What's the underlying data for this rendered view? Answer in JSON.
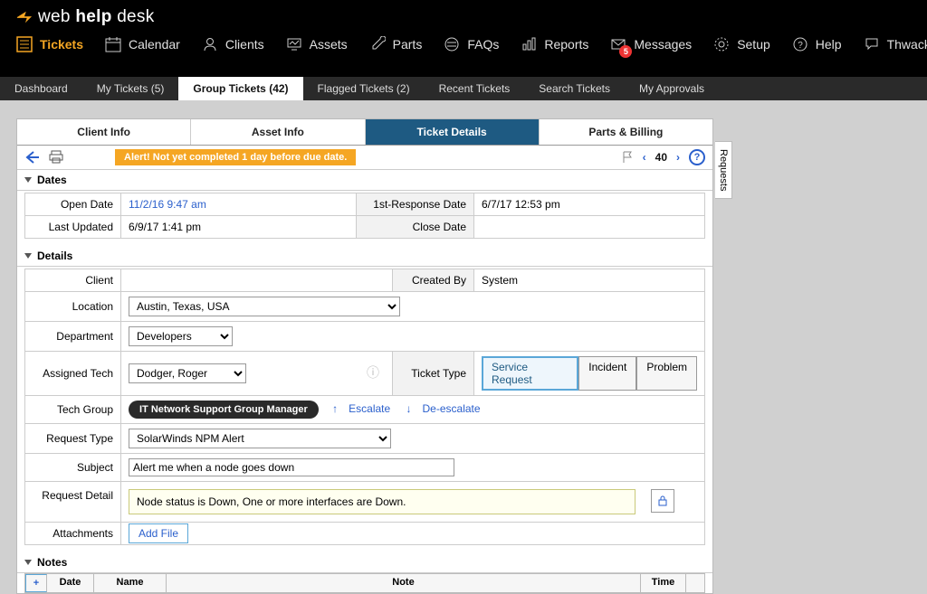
{
  "logo": {
    "part1": "web ",
    "part2": "help",
    "part3": " desk"
  },
  "mainnav": {
    "tickets": "Tickets",
    "calendar": "Calendar",
    "clients": "Clients",
    "assets": "Assets",
    "parts": "Parts",
    "faqs": "FAQs",
    "reports": "Reports",
    "messages": "Messages",
    "messages_badge": "5",
    "setup": "Setup",
    "help": "Help",
    "thwack": "Thwack"
  },
  "subnav": {
    "dashboard": "Dashboard",
    "mytickets": "My Tickets (5)",
    "grouptickets": "Group Tickets (42)",
    "flagged": "Flagged Tickets (2)",
    "recent": "Recent Tickets",
    "search": "Search Tickets",
    "approvals": "My Approvals"
  },
  "panel_tabs": {
    "clientinfo": "Client Info",
    "assetinfo": "Asset Info",
    "ticketdetails": "Ticket Details",
    "partsbilling": "Parts & Billing"
  },
  "alert": "Alert! Not yet completed 1 day before due date.",
  "pager_num": "40",
  "sections": {
    "dates": "Dates",
    "details": "Details",
    "notes": "Notes"
  },
  "dates": {
    "open_lbl": "Open Date",
    "open_val": "11/2/16 9:47 am",
    "first_lbl": "1st-Response Date",
    "first_val": "6/7/17 12:53 pm",
    "upd_lbl": "Last Updated",
    "upd_val": "6/9/17 1:41 pm",
    "close_lbl": "Close Date",
    "close_val": ""
  },
  "details": {
    "client_lbl": "Client",
    "client_val": "",
    "createdby_lbl": "Created By",
    "createdby_val": "System",
    "location_lbl": "Location",
    "location_val": "Austin, Texas, USA",
    "dept_lbl": "Department",
    "dept_val": "Developers",
    "tech_lbl": "Assigned Tech",
    "tech_val": "Dodger, Roger",
    "type_lbl": "Ticket Type",
    "type_opts": {
      "a": "Service Request",
      "b": "Incident",
      "c": "Problem"
    },
    "group_lbl": "Tech Group",
    "group_val": "IT Network Support  Group Manager",
    "escalate": "Escalate",
    "deescalate": "De-escalate",
    "reqtype_lbl": "Request Type",
    "reqtype_val": "SolarWinds NPM Alert",
    "subject_lbl": "Subject",
    "subject_val": "Alert me when a node goes down",
    "detail_lbl": "Request Detail",
    "detail_val": "Node status is Down, One or more interfaces are Down.",
    "attach_lbl": "Attachments",
    "addfile": "Add File"
  },
  "notes_cols": {
    "date": "Date",
    "name": "Name",
    "note": "Note",
    "time": "Time"
  },
  "side_tab": "Requests",
  "help_q": "?",
  "plus": "+"
}
